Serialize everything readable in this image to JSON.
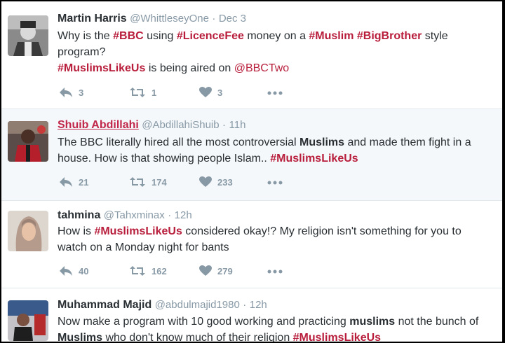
{
  "tweets": [
    {
      "name": "Martin Harris",
      "handle": "@WhittleseyOne",
      "sep": "·",
      "time": "Dec 3",
      "line1_a": "Why is the ",
      "line1_tag1": "#BBC",
      "line1_b": " using ",
      "line1_tag2": "#LicenceFee",
      "line1_c": " money on a ",
      "line1_tag3": "#Muslim",
      "line1_d": " ",
      "line1_tag4": "#BigBrother",
      "line1_e": " style program?",
      "line2_tag": "#MuslimsLikeUs",
      "line2_a": " is being aired on ",
      "line2_mention": "@BBCTwo",
      "replies": "3",
      "retweets": "1",
      "likes": "3"
    },
    {
      "name": "Shuib Abdillahi",
      "handle": "@AbdillahiShuib",
      "sep": "·",
      "time": "11h",
      "t_a": "The BBC literally hired all the most controversial ",
      "t_b": "Muslims",
      "t_c": " and made them fight in a house. How is that showing people Islam.. ",
      "t_tag": "#MuslimsLikeUs",
      "replies": "21",
      "retweets": "174",
      "likes": "233"
    },
    {
      "name": "tahmina",
      "handle": "@Tahxminax",
      "sep": "·",
      "time": "12h",
      "t_a": "How is ",
      "t_tag": "#MuslimsLikeUs",
      "t_b": " considered okay!? My religion isn't something for you to watch on a Monday night for bants",
      "replies": "40",
      "retweets": "162",
      "likes": "279"
    },
    {
      "name": "Muhammad Majid",
      "handle": "@abdulmajid1980",
      "sep": "·",
      "time": "12h",
      "t_a": "Now make a program with 10 good working and practicing ",
      "t_b": "muslims",
      "t_c": " not the bunch of ",
      "t_d": "Muslims",
      "t_e": " who don't know much of their religion ",
      "t_tag": "#MuslimsLikeUs"
    }
  ],
  "colors": {
    "hashtag": "#b81e3c",
    "action": "#8899a6",
    "highlight_bg": "#f5f8fa"
  },
  "icons": [
    "reply-icon",
    "retweet-icon",
    "like-icon",
    "more-icon"
  ]
}
